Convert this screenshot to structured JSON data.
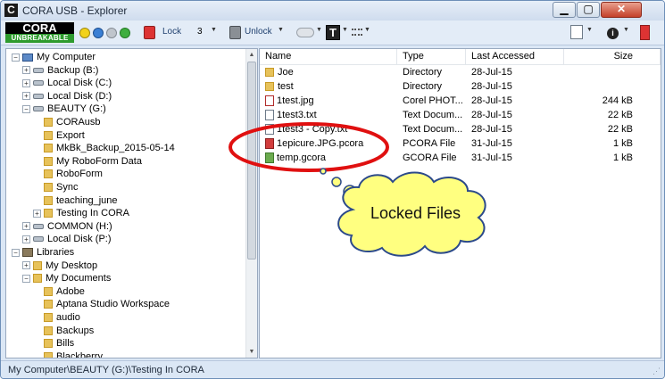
{
  "window": {
    "title": "CORA USB - Explorer"
  },
  "window_controls": {
    "minimize": "▁",
    "maximize": "▢",
    "close": "✕"
  },
  "toolbar": {
    "logo_top": "CORA",
    "logo_bottom": "UNBREAKABLE",
    "lock_label": "Lock",
    "lock_count": "3",
    "unlock_label": "Unlock",
    "caret": "▼"
  },
  "tree": {
    "items": [
      {
        "label": "My Computer",
        "expander": "−"
      },
      {
        "label": "Backup (B:)",
        "expander": "+"
      },
      {
        "label": "Local Disk (C:)",
        "expander": "+"
      },
      {
        "label": "Local Disk (D:)",
        "expander": "+"
      },
      {
        "label": "BEAUTY (G:)",
        "expander": "−"
      },
      {
        "label": "CORAusb",
        "expander": ""
      },
      {
        "label": "Export",
        "expander": ""
      },
      {
        "label": "MkBk_Backup_2015-05-14",
        "expander": ""
      },
      {
        "label": "My RoboForm Data",
        "expander": ""
      },
      {
        "label": "RoboForm",
        "expander": ""
      },
      {
        "label": "Sync",
        "expander": ""
      },
      {
        "label": "teaching_june",
        "expander": ""
      },
      {
        "label": "Testing In CORA",
        "expander": "+"
      },
      {
        "label": "COMMON (H:)",
        "expander": "+"
      },
      {
        "label": "Local Disk (P:)",
        "expander": "+"
      },
      {
        "label": "Libraries",
        "expander": "−"
      },
      {
        "label": "My Desktop",
        "expander": "+"
      },
      {
        "label": "My Documents",
        "expander": "−"
      },
      {
        "label": "Adobe",
        "expander": ""
      },
      {
        "label": "Aptana Studio Workspace",
        "expander": ""
      },
      {
        "label": "audio",
        "expander": ""
      },
      {
        "label": "Backups",
        "expander": ""
      },
      {
        "label": "Bills",
        "expander": ""
      },
      {
        "label": "Blackberry",
        "expander": ""
      }
    ]
  },
  "columns": {
    "name": "Name",
    "type": "Type",
    "accessed": "Last Accessed",
    "size": "Size"
  },
  "files": [
    {
      "name": "Joe",
      "type": "Directory",
      "accessed": "28-Jul-15",
      "size": ""
    },
    {
      "name": "test",
      "type": "Directory",
      "accessed": "28-Jul-15",
      "size": ""
    },
    {
      "name": "1test.jpg",
      "type": "Corel PHOT...",
      "accessed": "28-Jul-15",
      "size": "244 kB"
    },
    {
      "name": "1test3.txt",
      "type": "Text Docum...",
      "accessed": "28-Jul-15",
      "size": "22 kB"
    },
    {
      "name": "1test3 - Copy.txt",
      "type": "Text Docum...",
      "accessed": "28-Jul-15",
      "size": "22 kB"
    },
    {
      "name": "1epicure.JPG.pcora",
      "type": "PCORA File",
      "accessed": "31-Jul-15",
      "size": "1 kB"
    },
    {
      "name": "temp.gcora",
      "type": "GCORA File",
      "accessed": "31-Jul-15",
      "size": "1 kB"
    }
  ],
  "callout": {
    "text": "Locked Files"
  },
  "status": {
    "path": "My Computer\\BEAUTY (G:)\\Testing In CORA"
  },
  "colors": {
    "annotation": "#e01010",
    "callout_fill": "#ffff80"
  }
}
